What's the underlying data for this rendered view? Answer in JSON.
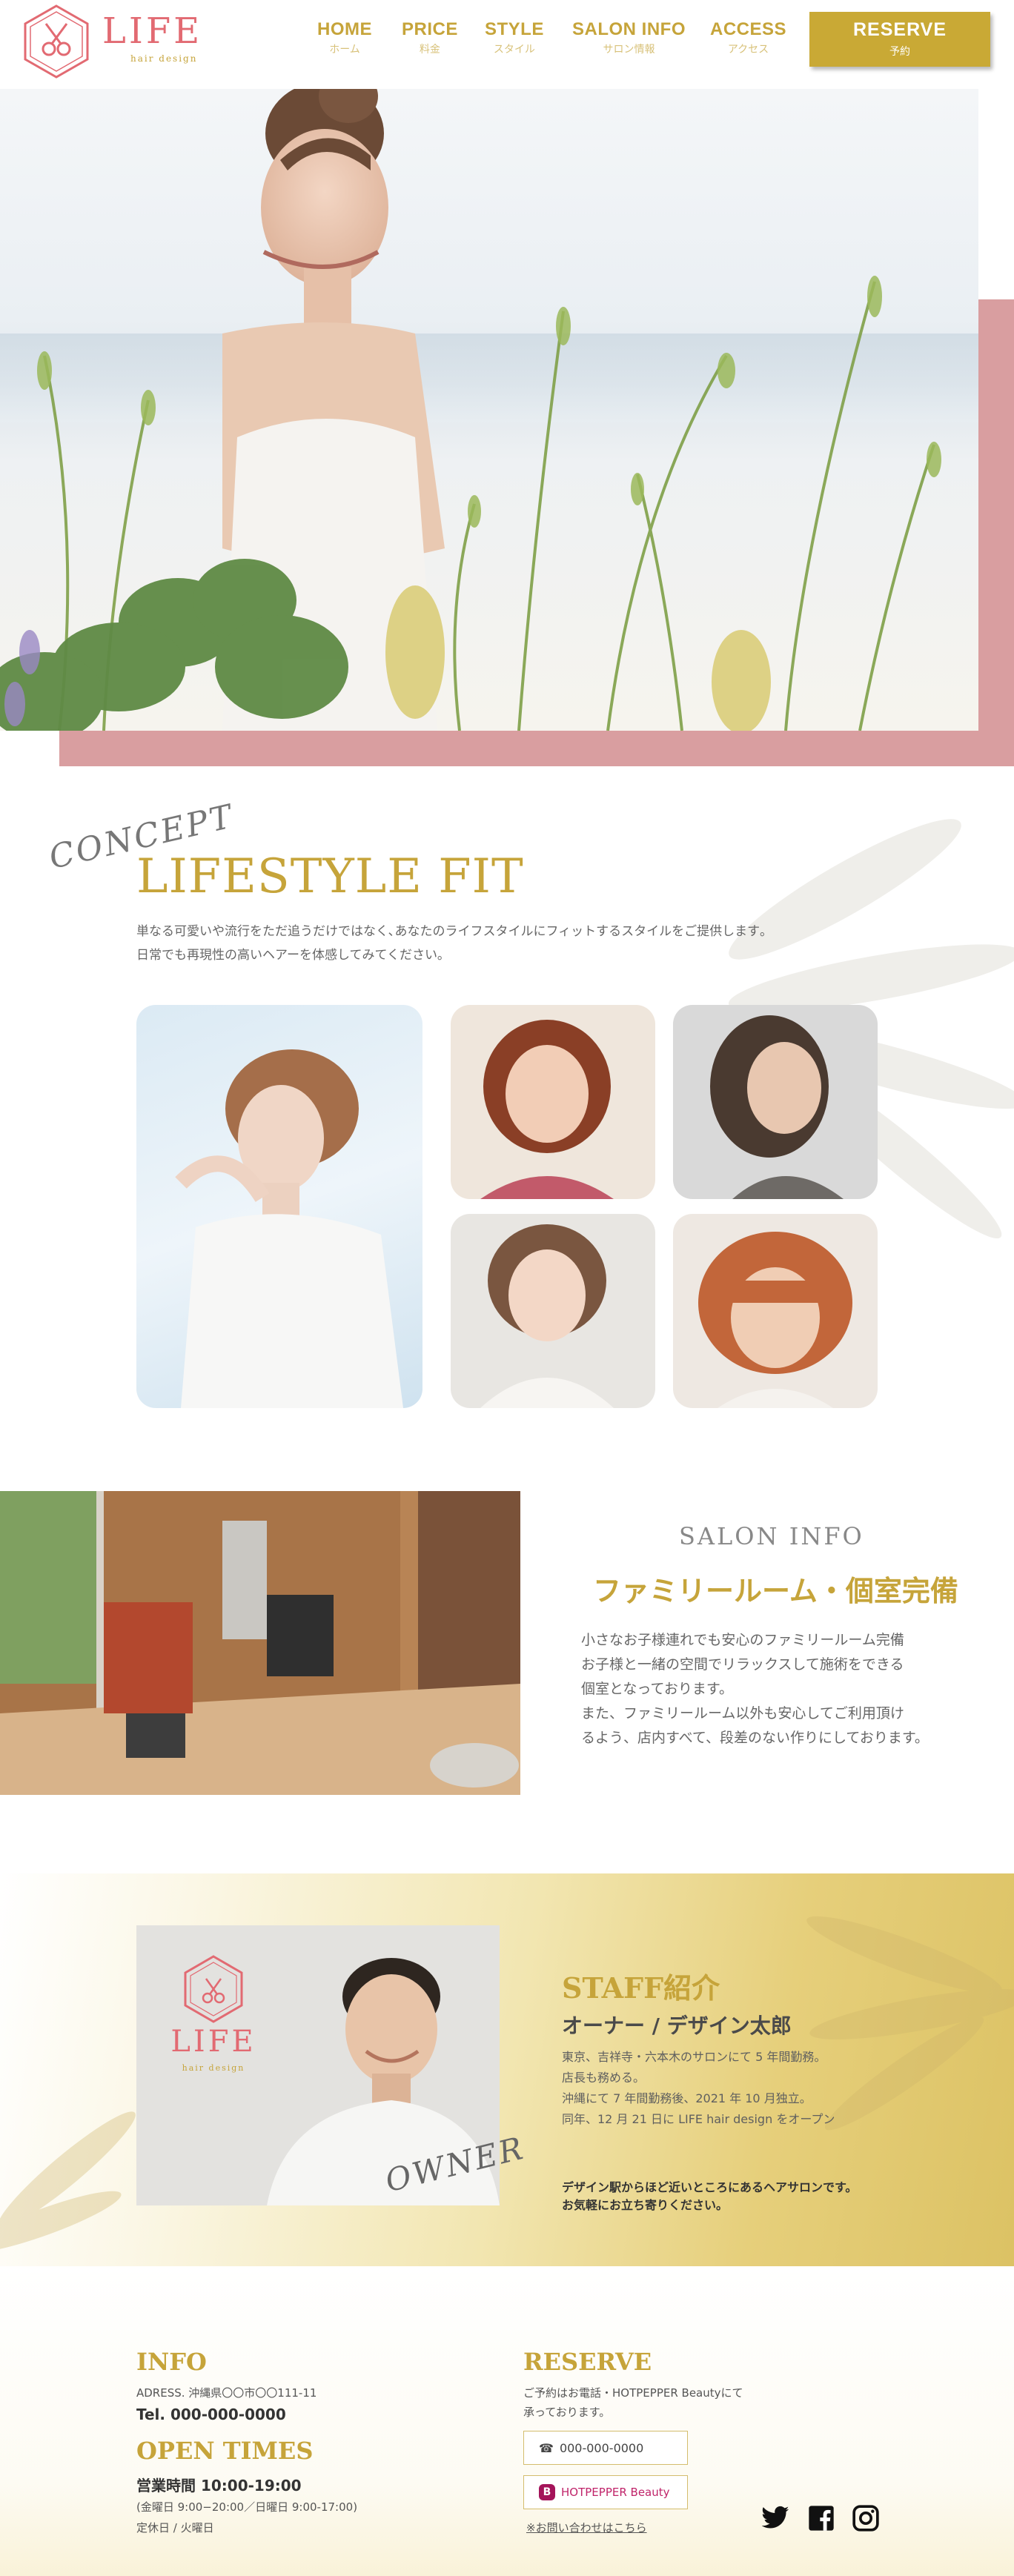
{
  "header": {
    "logo_text": "LIFE",
    "logo_sub": "hair design",
    "nav": [
      {
        "en": "HOME",
        "jp": "ホーム"
      },
      {
        "en": "PRICE",
        "jp": "料金"
      },
      {
        "en": "STYLE",
        "jp": "スタイル"
      },
      {
        "en": "SALON INFO",
        "jp": "サロン情報"
      },
      {
        "en": "ACCESS",
        "jp": "アクセス"
      }
    ],
    "reserve": {
      "en": "RESERVE",
      "jp": "予約"
    }
  },
  "concept": {
    "script_label": "CONCEPT",
    "title": "LIFESTYLE FIT",
    "lines": [
      "単なる可愛いや流行をただ追うだけではなく､あなたのライフスタイルにフィットするスタイルをご提供します｡",
      "日常でも再現性の高いヘアーを体感してみてください｡"
    ]
  },
  "salon": {
    "script_label": "SALON INFO",
    "title": "ファミリールーム・個室完備",
    "lines": [
      "小さなお子様連れでも安心のファミリールーム完備",
      "お子様と一緒の空間でリラックスして施術をできる",
      "個室となっております。",
      "また、ファミリールーム以外も安心してご利用頂け",
      "るよう、店内すべて、段差のない作りにしております。"
    ]
  },
  "staff": {
    "photo_logo_text": "LIFE",
    "photo_logo_sub": "hair design",
    "script_label": "OWNER",
    "title": "STAFF紹介",
    "role": "オーナー / デザイン太郎",
    "lines": [
      "東京、吉祥寺・六本木のサロンにて 5 年間勤務。",
      "店長も務める。",
      "沖縄にて 7 年間勤務後、2021 年 10 月独立。",
      "同年、12 月 21 日に LIFE hair design をオープン"
    ],
    "closing": [
      "デザイン駅からほど近いところにあるヘアサロンです。",
      "お気軽にお立ち寄りください。"
    ]
  },
  "footer": {
    "info": {
      "title": "INFO",
      "address": "ADRESS. 沖縄県〇〇市〇〇111-11",
      "tel": "Tel. 000-000-0000"
    },
    "open": {
      "title": "OPEN TIMES",
      "hours": "営業時間 10:00-19:00",
      "sub_hours": "(金曜日 9:00−20:00／日曜日 9:00-17:00)",
      "closed": "定休日 / 火曜日"
    },
    "reserve": {
      "title": "RESERVE",
      "lines": [
        "ご予約はお電話・HOTPEPPER Beautyにて",
        "承っております。"
      ],
      "phone": "000-000-0000",
      "hotpepper": "HOTPEPPER Beauty",
      "hotpepper_badge": "B",
      "contact": "※お問い合わせはこちら"
    },
    "social": [
      "twitter-icon",
      "facebook-icon",
      "instagram-icon"
    ]
  },
  "colors": {
    "gold": "#c6a43a",
    "pink": "#d99ea0",
    "logo_pink": "#e26a72",
    "button_gold": "#c9a935"
  }
}
